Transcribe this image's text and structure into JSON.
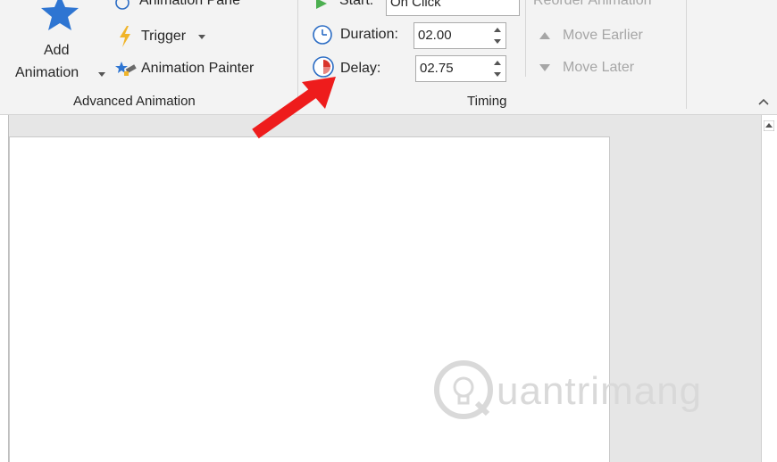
{
  "advanced_animation": {
    "add_animation_line1": "Add",
    "add_animation_line2": "Animation",
    "animation_pane": "Animation Pane",
    "trigger": "Trigger",
    "animation_painter": "Animation Painter",
    "group_label": "Advanced Animation"
  },
  "timing": {
    "start_label": "Start:",
    "start_value": "On Click",
    "duration_label": "Duration:",
    "duration_value": "02.00",
    "delay_label": "Delay:",
    "delay_value": "02.75",
    "reorder_label": "Reorder Animation",
    "move_earlier": "Move Earlier",
    "move_later": "Move Later",
    "group_label": "Timing"
  },
  "watermark": {
    "text": "uantrimang"
  },
  "colors": {
    "star_blue": "#2e75d2",
    "trigger_yellow": "#f0b429",
    "clock_blue": "#2b6cc4",
    "delay_red": "#d9342b",
    "arrow_red": "#ee1c1c"
  },
  "icons": [
    "star-icon",
    "animation-pane-icon",
    "lightning-icon",
    "animation-painter-icon",
    "play-icon",
    "clock-icon",
    "delay-clock-icon",
    "triangle-up-icon",
    "triangle-down-icon",
    "chevron-up-icon"
  ]
}
